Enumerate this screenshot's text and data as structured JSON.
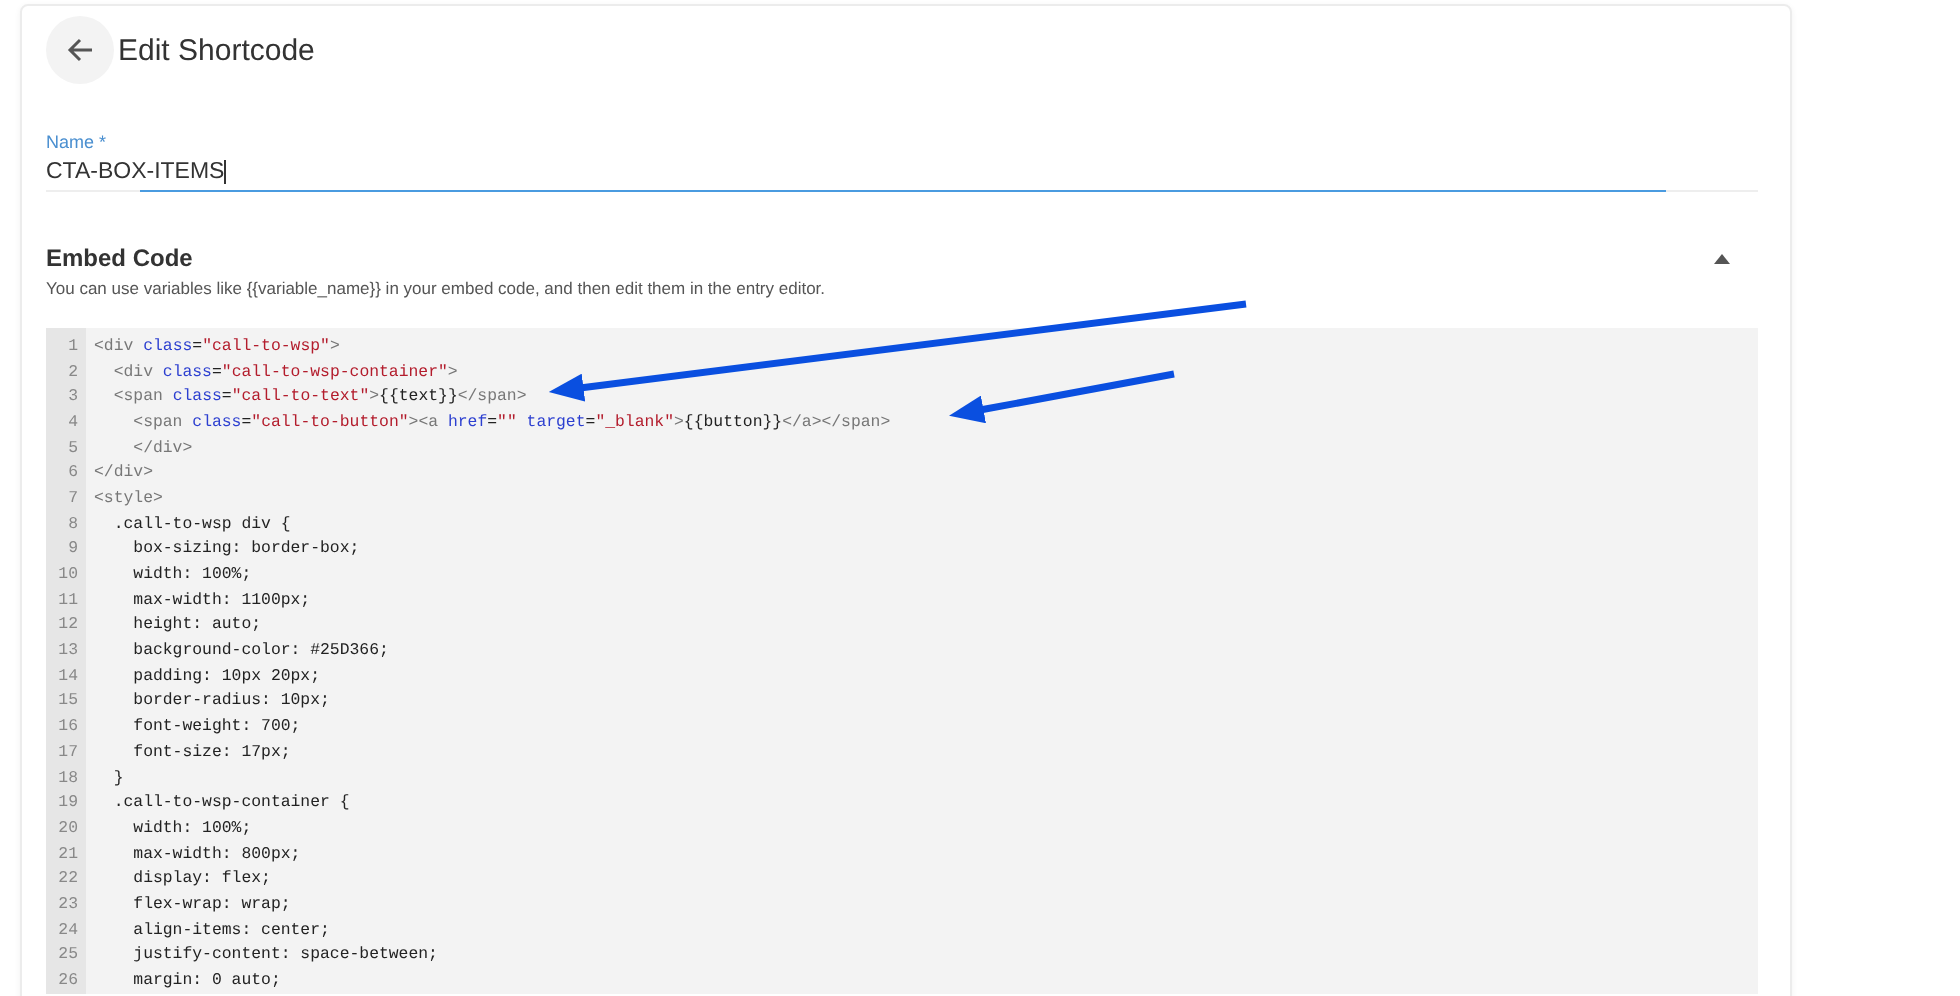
{
  "header": {
    "title": "Edit Shortcode"
  },
  "name_field": {
    "label": "Name *",
    "value": "CTA-BOX-ITEMS"
  },
  "embed_section": {
    "title": "Embed Code",
    "hint": "You can use variables like {{variable_name}} in your embed code, and then edit them in the entry editor.",
    "expanded": true
  },
  "code_editor": {
    "lines": [
      {
        "number": "1",
        "kind": "html",
        "text": "<div class=\"call-to-wsp\">"
      },
      {
        "number": "2",
        "kind": "html",
        "text": "  <div class=\"call-to-wsp-container\">"
      },
      {
        "number": "3",
        "kind": "html",
        "text": "  <span class=\"call-to-text\">{{text}}</span>"
      },
      {
        "number": "4",
        "kind": "html",
        "text": "    <span class=\"call-to-button\"><a href=\"\" target=\"_blank\">{{button}}</a></span>"
      },
      {
        "number": "5",
        "kind": "html",
        "text": "    </div>"
      },
      {
        "number": "6",
        "kind": "html",
        "text": "</div>"
      },
      {
        "number": "7",
        "kind": "html",
        "text": "<style>"
      },
      {
        "number": "8",
        "kind": "css",
        "text": "  .call-to-wsp div {"
      },
      {
        "number": "9",
        "kind": "css",
        "text": "    box-sizing: border-box;"
      },
      {
        "number": "10",
        "kind": "css",
        "text": "    width: 100%;"
      },
      {
        "number": "11",
        "kind": "css",
        "text": "    max-width: 1100px;"
      },
      {
        "number": "12",
        "kind": "css",
        "text": "    height: auto;"
      },
      {
        "number": "13",
        "kind": "css",
        "text": "    background-color: #25D366;"
      },
      {
        "number": "14",
        "kind": "css",
        "text": "    padding: 10px 20px;"
      },
      {
        "number": "15",
        "kind": "css",
        "text": "    border-radius: 10px;"
      },
      {
        "number": "16",
        "kind": "css",
        "text": "    font-weight: 700;"
      },
      {
        "number": "17",
        "kind": "css",
        "text": "    font-size: 17px;"
      },
      {
        "number": "18",
        "kind": "css",
        "text": "  }"
      },
      {
        "number": "19",
        "kind": "css",
        "text": "  .call-to-wsp-container {"
      },
      {
        "number": "20",
        "kind": "css",
        "text": "    width: 100%;"
      },
      {
        "number": "21",
        "kind": "css",
        "text": "    max-width: 800px;"
      },
      {
        "number": "22",
        "kind": "css",
        "text": "    display: flex;"
      },
      {
        "number": "23",
        "kind": "css",
        "text": "    flex-wrap: wrap;"
      },
      {
        "number": "24",
        "kind": "css",
        "text": "    align-items: center;"
      },
      {
        "number": "25",
        "kind": "css",
        "text": "    justify-content: space-between;"
      },
      {
        "number": "26",
        "kind": "css",
        "text": "    margin: 0 auto;"
      }
    ]
  }
}
